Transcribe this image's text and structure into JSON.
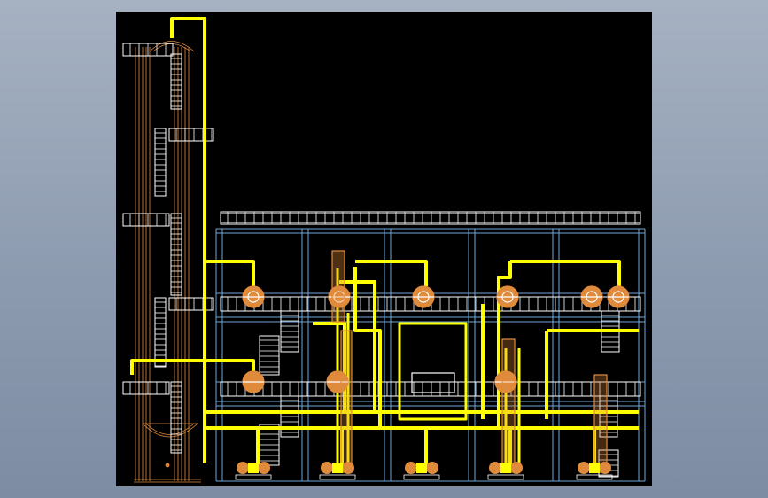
{
  "window": {
    "background": "#8fa0b5"
  },
  "viewport": {
    "background": "#000000",
    "colors": {
      "pipe": "#ffff00",
      "equipment": "#e08a3c",
      "steel": "#6fa6d8",
      "platform": "#ffffff"
    }
  },
  "drawing": {
    "column": "distillation-column",
    "vessel_stations": [
      "station-1",
      "station-2",
      "station-3",
      "station-4",
      "station-5"
    ],
    "pump_count": 5,
    "platform_levels": 3
  }
}
